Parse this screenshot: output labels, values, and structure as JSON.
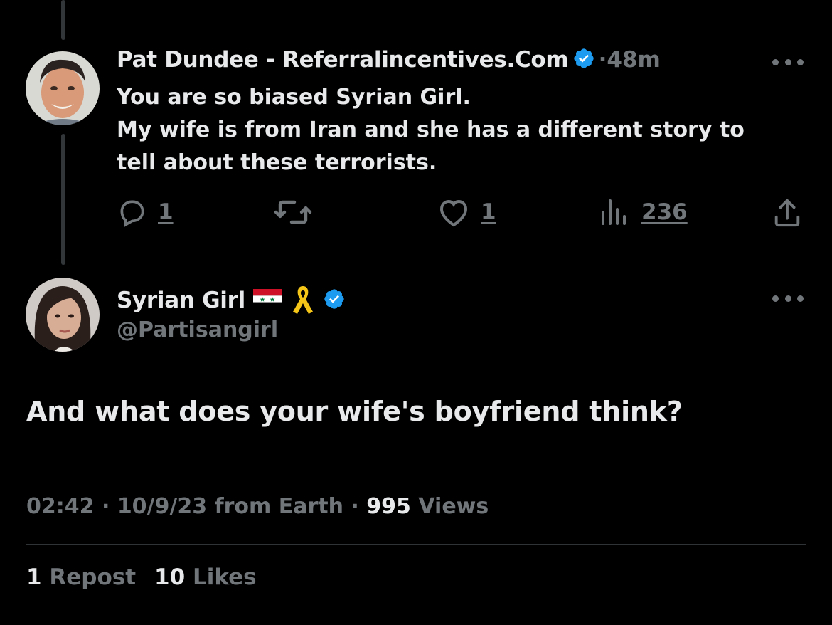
{
  "reply": {
    "display_name": "Pat Dundee - Referralincentives.Com",
    "separator": "·",
    "time": "48m",
    "text_lines": [
      "You are so biased Syrian Girl.",
      "My wife is from Iran and she has a different story to",
      "tell about these terrorists."
    ],
    "actions": {
      "reply_count": "1",
      "repost_count": "",
      "like_count": "1",
      "views_count": "236"
    }
  },
  "main": {
    "display_name": "Syrian Girl",
    "flag": "🇸🇾",
    "ribbon": "🎗",
    "handle": "@Partisangirl",
    "text": "And what does your wife's boyfriend think?",
    "meta": {
      "time": "02:42",
      "sep1": "·",
      "date": "10/9/23",
      "source": "from Earth",
      "sep2": "·",
      "views_count": "995",
      "views_label": "Views"
    },
    "stats": {
      "reposts_count": "1",
      "reposts_label": "Repost",
      "likes_count": "10",
      "likes_label": "Likes"
    }
  },
  "colors": {
    "background": "#000000",
    "text_primary": "#e7e9ea",
    "text_secondary": "#71767b",
    "verified": "#1d9bf0",
    "divider": "#2f3336"
  },
  "icons": [
    "reply-icon",
    "repost-icon",
    "like-icon",
    "views-icon",
    "share-icon",
    "verified-badge-icon",
    "more-icon"
  ]
}
